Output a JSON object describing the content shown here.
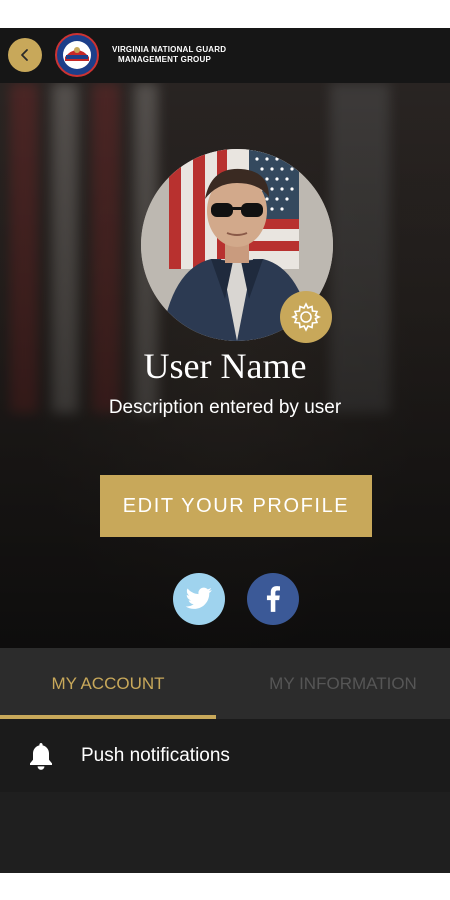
{
  "header": {
    "org_line1": "VIRGINIA NATIONAL GUARD",
    "org_line2": "MANAGEMENT GROUP",
    "back_icon": "chevron-left-icon",
    "logo_icon": "organization-seal"
  },
  "profile": {
    "user_name": "User Name",
    "description": "Description entered by user",
    "edit_button_label": "EDIT YOUR PROFILE",
    "settings_icon": "gear-icon"
  },
  "social": {
    "twitter_icon": "twitter-icon",
    "facebook_icon": "facebook-icon"
  },
  "tabs": [
    {
      "label": "MY ACCOUNT",
      "active": true
    },
    {
      "label": "MY INFORMATION",
      "active": false
    }
  ],
  "settings_list": [
    {
      "icon": "bell-icon",
      "label": "Push notifications"
    }
  ],
  "colors": {
    "accent": "#c8a85a",
    "twitter": "#9fd3ee",
    "facebook": "#3b5997",
    "background": "#1c1c1c",
    "inactive_tab_text": "#565656"
  }
}
